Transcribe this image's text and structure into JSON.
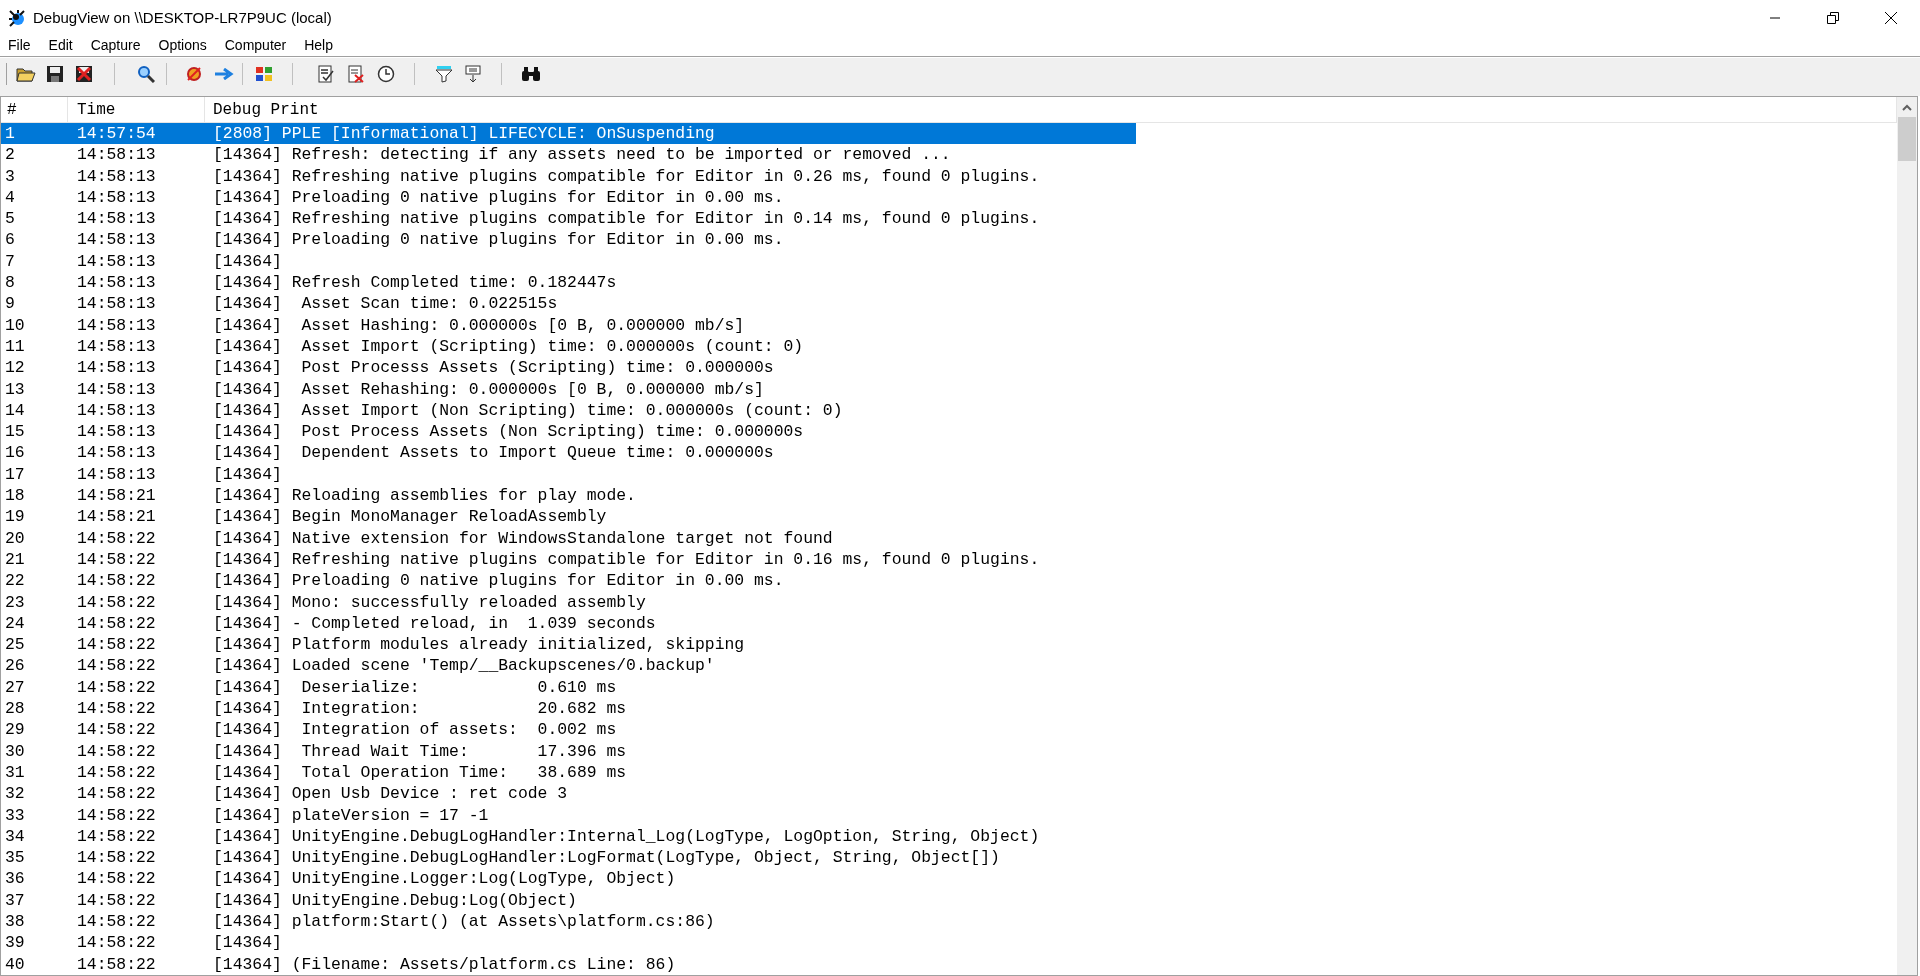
{
  "window": {
    "title": "DebugView on \\\\DESKTOP-LR7P9UC (local)"
  },
  "menu": [
    "File",
    "Edit",
    "Capture",
    "Options",
    "Computer",
    "Help"
  ],
  "table": {
    "columns": [
      "#",
      "Time",
      "Debug Print"
    ],
    "rows": [
      {
        "n": "1",
        "time": "14:57:54",
        "text": "[2808] PPLE [Informational] LIFECYCLE: OnSuspending",
        "selected": true
      },
      {
        "n": "2",
        "time": "14:58:13",
        "text": "[14364] Refresh: detecting if any assets need to be imported or removed ...",
        "selected": false
      },
      {
        "n": "3",
        "time": "14:58:13",
        "text": "[14364] Refreshing native plugins compatible for Editor in 0.26 ms, found 0 plugins.",
        "selected": false
      },
      {
        "n": "4",
        "time": "14:58:13",
        "text": "[14364] Preloading 0 native plugins for Editor in 0.00 ms.",
        "selected": false
      },
      {
        "n": "5",
        "time": "14:58:13",
        "text": "[14364] Refreshing native plugins compatible for Editor in 0.14 ms, found 0 plugins.",
        "selected": false
      },
      {
        "n": "6",
        "time": "14:58:13",
        "text": "[14364] Preloading 0 native plugins for Editor in 0.00 ms.",
        "selected": false
      },
      {
        "n": "7",
        "time": "14:58:13",
        "text": "[14364]",
        "selected": false
      },
      {
        "n": "8",
        "time": "14:58:13",
        "text": "[14364] Refresh Completed time: 0.182447s",
        "selected": false
      },
      {
        "n": "9",
        "time": "14:58:13",
        "text": "[14364]  Asset Scan time: 0.022515s",
        "selected": false
      },
      {
        "n": "10",
        "time": "14:58:13",
        "text": "[14364]  Asset Hashing: 0.000000s [0 B, 0.000000 mb/s]",
        "selected": false
      },
      {
        "n": "11",
        "time": "14:58:13",
        "text": "[14364]  Asset Import (Scripting) time: 0.000000s (count: 0)",
        "selected": false
      },
      {
        "n": "12",
        "time": "14:58:13",
        "text": "[14364]  Post Processs Assets (Scripting) time: 0.000000s",
        "selected": false
      },
      {
        "n": "13",
        "time": "14:58:13",
        "text": "[14364]  Asset Rehashing: 0.000000s [0 B, 0.000000 mb/s]",
        "selected": false
      },
      {
        "n": "14",
        "time": "14:58:13",
        "text": "[14364]  Asset Import (Non Scripting) time: 0.000000s (count: 0)",
        "selected": false
      },
      {
        "n": "15",
        "time": "14:58:13",
        "text": "[14364]  Post Process Assets (Non Scripting) time: 0.000000s",
        "selected": false
      },
      {
        "n": "16",
        "time": "14:58:13",
        "text": "[14364]  Dependent Assets to Import Queue time: 0.000000s",
        "selected": false
      },
      {
        "n": "17",
        "time": "14:58:13",
        "text": "[14364]",
        "selected": false
      },
      {
        "n": "18",
        "time": "14:58:21",
        "text": "[14364] Reloading assemblies for play mode.",
        "selected": false
      },
      {
        "n": "19",
        "time": "14:58:21",
        "text": "[14364] Begin MonoManager ReloadAssembly",
        "selected": false
      },
      {
        "n": "20",
        "time": "14:58:22",
        "text": "[14364] Native extension for WindowsStandalone target not found",
        "selected": false
      },
      {
        "n": "21",
        "time": "14:58:22",
        "text": "[14364] Refreshing native plugins compatible for Editor in 0.16 ms, found 0 plugins.",
        "selected": false
      },
      {
        "n": "22",
        "time": "14:58:22",
        "text": "[14364] Preloading 0 native plugins for Editor in 0.00 ms.",
        "selected": false
      },
      {
        "n": "23",
        "time": "14:58:22",
        "text": "[14364] Mono: successfully reloaded assembly",
        "selected": false
      },
      {
        "n": "24",
        "time": "14:58:22",
        "text": "[14364] - Completed reload, in  1.039 seconds",
        "selected": false
      },
      {
        "n": "25",
        "time": "14:58:22",
        "text": "[14364] Platform modules already initialized, skipping",
        "selected": false
      },
      {
        "n": "26",
        "time": "14:58:22",
        "text": "[14364] Loaded scene 'Temp/__Backupscenes/0.backup'",
        "selected": false
      },
      {
        "n": "27",
        "time": "14:58:22",
        "text": "[14364]  Deserialize:            0.610 ms",
        "selected": false
      },
      {
        "n": "28",
        "time": "14:58:22",
        "text": "[14364]  Integration:            20.682 ms",
        "selected": false
      },
      {
        "n": "29",
        "time": "14:58:22",
        "text": "[14364]  Integration of assets:  0.002 ms",
        "selected": false
      },
      {
        "n": "30",
        "time": "14:58:22",
        "text": "[14364]  Thread Wait Time:       17.396 ms",
        "selected": false
      },
      {
        "n": "31",
        "time": "14:58:22",
        "text": "[14364]  Total Operation Time:   38.689 ms",
        "selected": false
      },
      {
        "n": "32",
        "time": "14:58:22",
        "text": "[14364] Open Usb Device : ret code 3",
        "selected": false
      },
      {
        "n": "33",
        "time": "14:58:22",
        "text": "[14364] plateVersion = 17 -1",
        "selected": false
      },
      {
        "n": "34",
        "time": "14:58:22",
        "text": "[14364] UnityEngine.DebugLogHandler:Internal_Log(LogType, LogOption, String, Object)",
        "selected": false
      },
      {
        "n": "35",
        "time": "14:58:22",
        "text": "[14364] UnityEngine.DebugLogHandler:LogFormat(LogType, Object, String, Object[])",
        "selected": false
      },
      {
        "n": "36",
        "time": "14:58:22",
        "text": "[14364] UnityEngine.Logger:Log(LogType, Object)",
        "selected": false
      },
      {
        "n": "37",
        "time": "14:58:22",
        "text": "[14364] UnityEngine.Debug:Log(Object)",
        "selected": false
      },
      {
        "n": "38",
        "time": "14:58:22",
        "text": "[14364] platform:Start() (at Assets\\platform.cs:86)",
        "selected": false
      },
      {
        "n": "39",
        "time": "14:58:22",
        "text": "[14364]",
        "selected": false
      },
      {
        "n": "40",
        "time": "14:58:22",
        "text": "[14364] (Filename: Assets/platform.cs Line: 86)",
        "selected": false
      }
    ]
  }
}
